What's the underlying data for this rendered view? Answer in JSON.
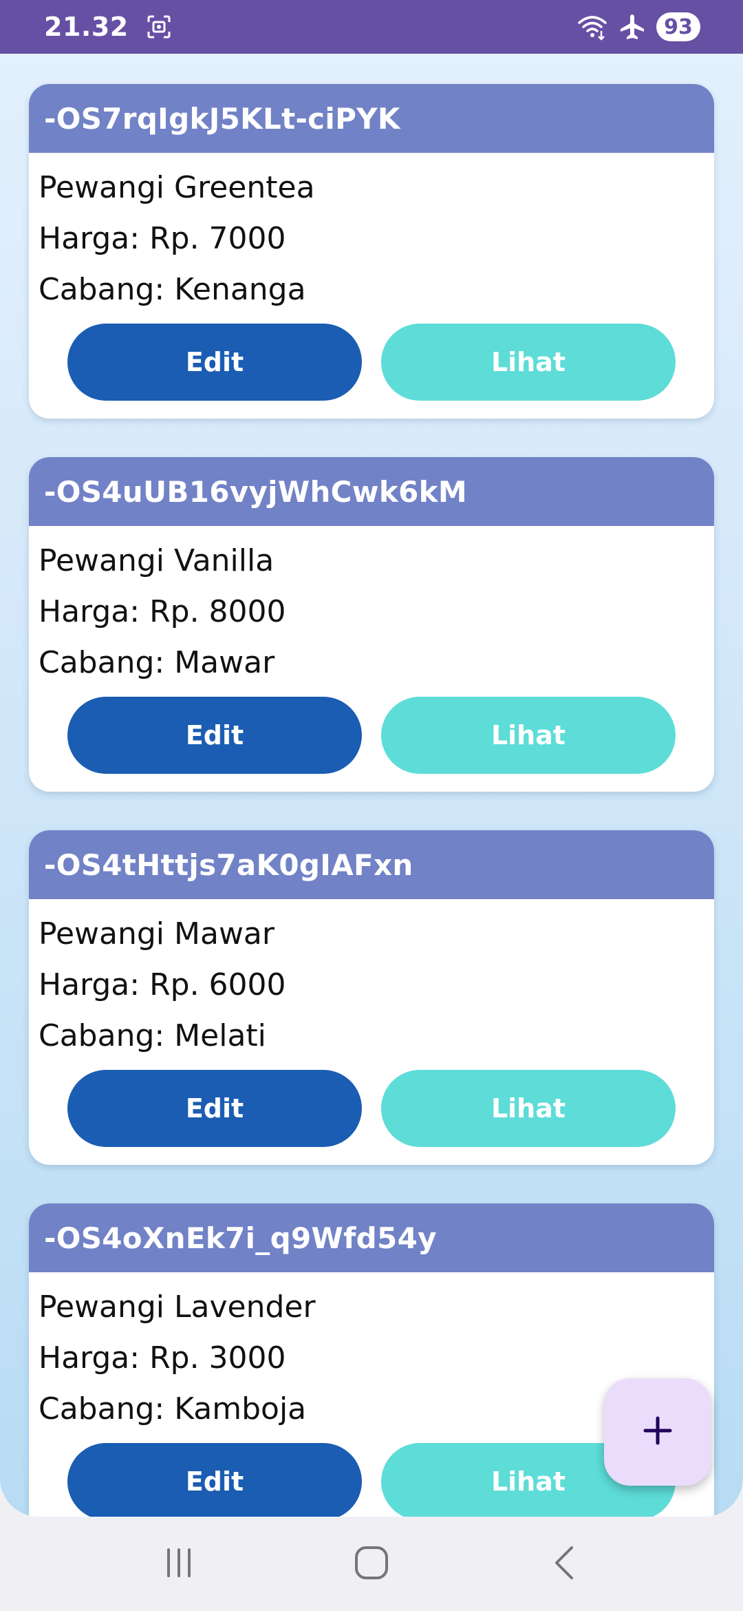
{
  "status_bar": {
    "time": "21.32",
    "battery": "93",
    "icons": [
      "screenshot-icon",
      "wifi-icon",
      "airplane-mode-icon",
      "battery-icon"
    ]
  },
  "items": [
    {
      "id": "-OS7rqIgkJ5KLt-ciPYK",
      "name": "Pewangi Greentea",
      "price": "Harga: Rp. 7000",
      "branch": "Cabang: Kenanga"
    },
    {
      "id": "-OS4uUB16vyjWhCwk6kM",
      "name": "Pewangi Vanilla",
      "price": "Harga: Rp. 8000",
      "branch": "Cabang: Mawar"
    },
    {
      "id": "-OS4tHttjs7aK0gIAFxn",
      "name": "Pewangi Mawar",
      "price": "Harga: Rp. 6000",
      "branch": "Cabang: Melati"
    },
    {
      "id": "-OS4oXnEk7i_q9Wfd54y",
      "name": "Pewangi Lavender",
      "price": "Harga: Rp. 3000",
      "branch": "Cabang: Kamboja"
    }
  ],
  "actions": {
    "edit_label": "Edit",
    "view_label": "Lihat"
  },
  "fab": {
    "icon": "plus-icon"
  },
  "nav_bar": {
    "icons": [
      "recent-apps-icon",
      "home-icon",
      "back-icon"
    ]
  },
  "colors": {
    "status_bar": "#6650a4",
    "card_header": "#7282c6",
    "edit_button": "#1a5db2",
    "view_button": "#5ddcd8",
    "fab_background": "#ebdcfb",
    "fab_icon": "#21005d"
  }
}
